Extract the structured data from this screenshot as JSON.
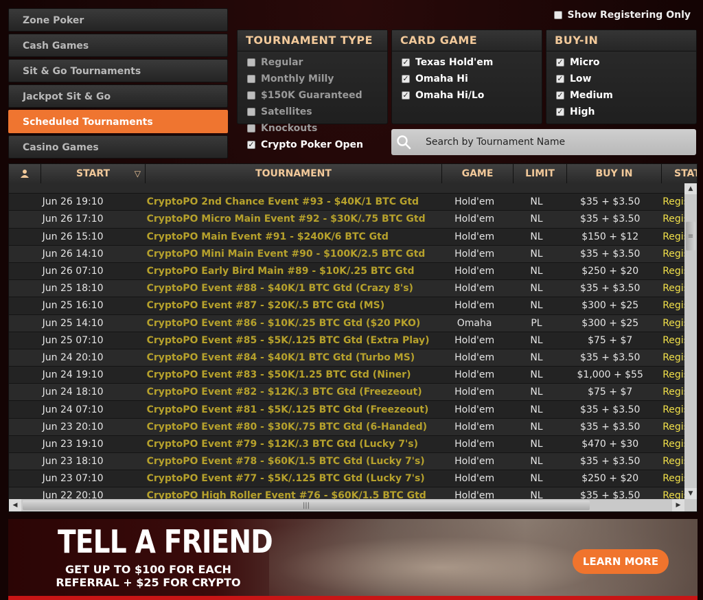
{
  "nav": {
    "items": [
      {
        "label": "Zone Poker",
        "active": false
      },
      {
        "label": "Cash Games",
        "active": false
      },
      {
        "label": "Sit & Go Tournaments",
        "active": false
      },
      {
        "label": "Jackpot Sit & Go",
        "active": false
      },
      {
        "label": "Scheduled Tournaments",
        "active": true
      },
      {
        "label": "Casino Games",
        "active": false
      }
    ]
  },
  "show_registering": {
    "label": "Show Registering Only",
    "checked": false
  },
  "filters": {
    "tournament_type": {
      "title": "TOURNAMENT TYPE",
      "options": [
        {
          "label": "Regular",
          "checked": false
        },
        {
          "label": "Monthly Milly",
          "checked": false
        },
        {
          "label": "$150K Guaranteed",
          "checked": false
        },
        {
          "label": "Satellites",
          "checked": false
        },
        {
          "label": "Knockouts",
          "checked": false
        },
        {
          "label": "Crypto Poker Open",
          "checked": true
        }
      ]
    },
    "card_game": {
      "title": "CARD GAME",
      "options": [
        {
          "label": "Texas Hold'em",
          "checked": true
        },
        {
          "label": "Omaha Hi",
          "checked": true
        },
        {
          "label": "Omaha Hi/Lo",
          "checked": true
        }
      ]
    },
    "buy_in": {
      "title": "BUY-IN",
      "options": [
        {
          "label": "Micro",
          "checked": true
        },
        {
          "label": "Low",
          "checked": true
        },
        {
          "label": "Medium",
          "checked": true
        },
        {
          "label": "High",
          "checked": true
        }
      ]
    }
  },
  "search": {
    "placeholder": "Search by Tournament Name",
    "icon": "search-icon"
  },
  "table": {
    "headers": {
      "icon": "person-icon",
      "start": "START",
      "tournament": "TOURNAMENT",
      "game": "GAME",
      "limit": "LIMIT",
      "buy_in": "BUY IN",
      "status": "STATUS"
    },
    "sort_indicator": "▽",
    "rows": [
      {
        "start": "Jun 26 19:10",
        "name": "CryptoPO 2nd Chance Event #93 - $40K/1 BTC Gtd",
        "game": "Hold'em",
        "limit": "NL",
        "buy_in": "$35 + $3.50",
        "status": "Registering"
      },
      {
        "start": "Jun 26 17:10",
        "name": "CryptoPO Micro Main Event #92 - $30K/.75 BTC Gtd",
        "game": "Hold'em",
        "limit": "NL",
        "buy_in": "$35 + $3.50",
        "status": "Registering"
      },
      {
        "start": "Jun 26 15:10",
        "name": "CryptoPO Main Event #91 - $240K/6 BTC Gtd",
        "game": "Hold'em",
        "limit": "NL",
        "buy_in": "$150 + $12",
        "status": "Registering"
      },
      {
        "start": "Jun 26 14:10",
        "name": "CryptoPO Mini Main Event #90 - $100K/2.5 BTC Gtd",
        "game": "Hold'em",
        "limit": "NL",
        "buy_in": "$35 + $3.50",
        "status": "Registering"
      },
      {
        "start": "Jun 26 07:10",
        "name": "CryptoPO Early Bird Main #89 - $10K/.25 BTC Gtd",
        "game": "Hold'em",
        "limit": "NL",
        "buy_in": "$250 + $20",
        "status": "Registering"
      },
      {
        "start": "Jun 25 18:10",
        "name": "CryptoPO Event #88 - $40K/1 BTC Gtd (Crazy 8's)",
        "game": "Hold'em",
        "limit": "NL",
        "buy_in": "$35 + $3.50",
        "status": "Registering"
      },
      {
        "start": "Jun 25 16:10",
        "name": "CryptoPO Event #87 - $20K/.5 BTC Gtd (MS)",
        "game": "Hold'em",
        "limit": "NL",
        "buy_in": "$300 + $25",
        "status": "Registering"
      },
      {
        "start": "Jun 25 14:10",
        "name": "CryptoPO Event #86 - $10K/.25 BTC Gtd ($20 PKO)",
        "game": "Omaha",
        "limit": "PL",
        "buy_in": "$300 + $25",
        "status": "Registering"
      },
      {
        "start": "Jun 25 07:10",
        "name": "CryptoPO Event #85 - $5K/.125 BTC Gtd (Extra Play)",
        "game": "Hold'em",
        "limit": "NL",
        "buy_in": "$75 + $7",
        "status": "Registering"
      },
      {
        "start": "Jun 24 20:10",
        "name": "CryptoPO Event #84 - $40K/1 BTC Gtd (Turbo MS)",
        "game": "Hold'em",
        "limit": "NL",
        "buy_in": "$35 + $3.50",
        "status": "Registering"
      },
      {
        "start": "Jun 24 19:10",
        "name": "CryptoPO Event #83 - $50K/1.25 BTC Gtd (Niner)",
        "game": "Hold'em",
        "limit": "NL",
        "buy_in": "$1,000 + $55",
        "status": "Registering"
      },
      {
        "start": "Jun 24 18:10",
        "name": "CryptoPO Event #82 - $12K/.3 BTC Gtd (Freezeout)",
        "game": "Hold'em",
        "limit": "NL",
        "buy_in": "$75 + $7",
        "status": "Registering"
      },
      {
        "start": "Jun 24 07:10",
        "name": "CryptoPO Event #81 - $5K/.125 BTC Gtd (Freezeout)",
        "game": "Hold'em",
        "limit": "NL",
        "buy_in": "$35 + $3.50",
        "status": "Registering"
      },
      {
        "start": "Jun 23 20:10",
        "name": "CryptoPO Event #80 - $30K/.75 BTC Gtd (6-Handed)",
        "game": "Hold'em",
        "limit": "NL",
        "buy_in": "$35 + $3.50",
        "status": "Registering"
      },
      {
        "start": "Jun 23 19:10",
        "name": "CryptoPO Event #79 - $12K/.3 BTC Gtd (Lucky 7's)",
        "game": "Hold'em",
        "limit": "NL",
        "buy_in": "$470 + $30",
        "status": "Registering"
      },
      {
        "start": "Jun 23 18:10",
        "name": "CryptoPO Event #78 - $60K/1.5 BTC Gtd (Lucky 7's)",
        "game": "Hold'em",
        "limit": "NL",
        "buy_in": "$35 + $3.50",
        "status": "Registering"
      },
      {
        "start": "Jun 23 07:10",
        "name": "CryptoPO Event #77 - $5K/.125 BTC Gtd (Lucky 7's)",
        "game": "Hold'em",
        "limit": "NL",
        "buy_in": "$250 + $20",
        "status": "Registering"
      },
      {
        "start": "Jun 22 20:10",
        "name": "CryptoPO High Roller Event #76 - $60K/1.5 BTC Gtd",
        "game": "Hold'em",
        "limit": "NL",
        "buy_in": "$35 + $3.50",
        "status": "Registering"
      }
    ]
  },
  "banner": {
    "title": "TELL A FRIEND",
    "subtitle": "GET UP TO $100 FOR EACH REFERRAL + $25 FOR CRYPTO",
    "cta": "LEARN MORE"
  },
  "colors": {
    "accent": "#ef7530",
    "heading": "#f2c99a",
    "tournament_name": "#b6a12c",
    "status": "#f1e04a"
  }
}
